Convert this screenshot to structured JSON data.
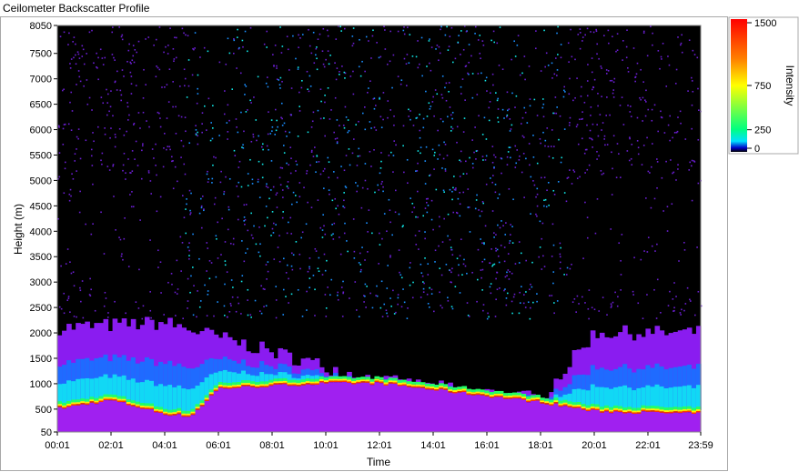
{
  "window": {
    "title": "Ceilometer Backscatter Profile"
  },
  "colors": {
    "background": "#000000",
    "scale_stops": [
      "#0000c8",
      "#8000ff",
      "#2080ff",
      "#00e0ff",
      "#00ff80",
      "#ffff00",
      "#ff8000",
      "#ff0000"
    ]
  },
  "chart_data": {
    "type": "heatmap",
    "title": "",
    "xlabel": "Time",
    "ylabel": "Height (m)",
    "x_ticks": [
      "00:01",
      "02:01",
      "04:01",
      "06:01",
      "08:01",
      "10:01",
      "12:01",
      "14:01",
      "16:01",
      "18:01",
      "20:01",
      "22:01",
      "23:59"
    ],
    "y_ticks": [
      50,
      500,
      1000,
      1500,
      2000,
      2500,
      3000,
      3500,
      4000,
      4500,
      5000,
      5500,
      6000,
      6500,
      7000,
      7500,
      8050
    ],
    "ylim": [
      50,
      8050
    ],
    "xlim": [
      "00:01",
      "23:59"
    ],
    "colorbar": {
      "label": "Intensity",
      "ticks": [
        0,
        250,
        750,
        1500
      ],
      "range": [
        0,
        1500
      ]
    },
    "features": {
      "boundary_layer_top_m": [
        {
          "time": "00:01",
          "height": 2100
        },
        {
          "time": "04:01",
          "height": 2200
        },
        {
          "time": "12:01",
          "height": 1050
        },
        {
          "time": "18:01",
          "height": 700
        },
        {
          "time": "20:01",
          "height": 2000
        },
        {
          "time": "23:59",
          "height": 2000
        }
      ],
      "aerosol_layer_m": [
        {
          "time": "00:01",
          "height": 550
        },
        {
          "time": "02:01",
          "height": 720
        },
        {
          "time": "04:01",
          "height": 450
        },
        {
          "time": "05:00",
          "height": 400
        },
        {
          "time": "06:01",
          "height": 950
        },
        {
          "time": "08:01",
          "height": 1000
        },
        {
          "time": "10:01",
          "height": 1050
        },
        {
          "time": "12:01",
          "height": 1050
        },
        {
          "time": "18:01",
          "height": 680
        },
        {
          "time": "20:01",
          "height": 500
        },
        {
          "time": "23:59",
          "height": 450
        }
      ]
    },
    "grid": false,
    "legend": "colorbar-right"
  }
}
